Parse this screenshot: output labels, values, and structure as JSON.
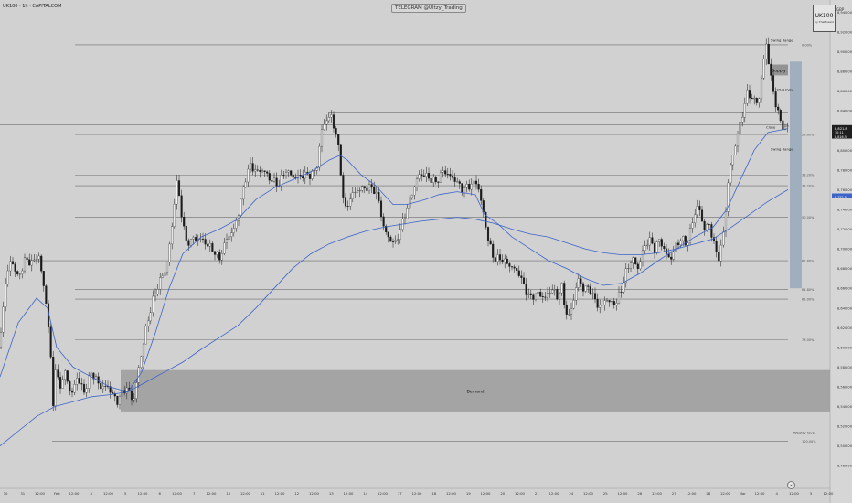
{
  "header": {
    "symbol": "UK100 · 1h · CAPITALCOM",
    "telegram": "TELEGRAM @Ultzy_Trading",
    "logo_title": "UK100",
    "logo_sub": "by TheMosaid",
    "currency": "GBP",
    "scroll_icon": "chevron-down-icon"
  },
  "colors": {
    "background": "#d1d1d1",
    "candle": "#1a1a1a",
    "ma_fast": "#3b63c8",
    "ma_slow": "#3b63c8",
    "zone_fill": "#9c9c9c",
    "fib_bar": "#8fa3b5",
    "price_badge": "#1f1f1f",
    "ma_badge": "#3b63c8"
  },
  "chart_data": {
    "type": "candlestick",
    "ylim": [
      8470,
      8945
    ],
    "y_ticks": [
      "8,940.00",
      "8,920.00",
      "8,900.00",
      "8,880.00",
      "8,860.00",
      "8,840.00",
      "8,820.00",
      "8,800.00",
      "8,780.00",
      "8,760.00",
      "8,740.00",
      "8,720.00",
      "8,700.00",
      "8,680.00",
      "8,660.00",
      "8,640.00",
      "8,620.00",
      "8,600.00",
      "8,580.00",
      "8,560.00",
      "8,540.00",
      "8,520.00",
      "8,500.00",
      "8,480.00"
    ],
    "x_ticks": [
      "30",
      "31",
      "12:00",
      "Feb",
      "12:00",
      "4",
      "12:00",
      "5",
      "12:00",
      "6",
      "12:00",
      "7",
      "12:00",
      "10",
      "12:00",
      "11",
      "12:00",
      "12",
      "12:00",
      "13",
      "12:00",
      "14",
      "12:00",
      "17",
      "12:00",
      "18",
      "12:00",
      "19",
      "12:00",
      "20",
      "12:00",
      "21",
      "12:00",
      "24",
      "12:00",
      "25",
      "12:00",
      "26",
      "12:00",
      "27",
      "12:00",
      "28",
      "12:00",
      "Mar",
      "12:00",
      "4",
      "12:00",
      "5",
      "12:00"
    ],
    "close_path": [
      [
        0,
        8600
      ],
      [
        5,
        8660
      ],
      [
        12,
        8690
      ],
      [
        20,
        8670
      ],
      [
        28,
        8690
      ],
      [
        35,
        8685
      ],
      [
        42,
        8695
      ],
      [
        50,
        8650
      ],
      [
        55,
        8600
      ],
      [
        58,
        8540
      ],
      [
        60,
        8580
      ],
      [
        65,
        8560
      ],
      [
        72,
        8575
      ],
      [
        78,
        8550
      ],
      [
        84,
        8570
      ],
      [
        92,
        8555
      ],
      [
        100,
        8575
      ],
      [
        110,
        8560
      ],
      [
        118,
        8560
      ],
      [
        128,
        8545
      ],
      [
        138,
        8560
      ],
      [
        146,
        8545
      ],
      [
        152,
        8580
      ],
      [
        160,
        8620
      ],
      [
        168,
        8650
      ],
      [
        176,
        8670
      ],
      [
        182,
        8680
      ],
      [
        188,
        8720
      ],
      [
        193,
        8770
      ],
      [
        198,
        8740
      ],
      [
        204,
        8705
      ],
      [
        210,
        8710
      ],
      [
        220,
        8710
      ],
      [
        232,
        8700
      ],
      [
        240,
        8690
      ],
      [
        248,
        8710
      ],
      [
        256,
        8720
      ],
      [
        262,
        8740
      ],
      [
        268,
        8770
      ],
      [
        274,
        8785
      ],
      [
        280,
        8778
      ],
      [
        288,
        8780
      ],
      [
        296,
        8770
      ],
      [
        305,
        8765
      ],
      [
        312,
        8780
      ],
      [
        322,
        8772
      ],
      [
        332,
        8775
      ],
      [
        340,
        8775
      ],
      [
        346,
        8780
      ],
      [
        352,
        8820
      ],
      [
        356,
        8830
      ],
      [
        362,
        8835
      ],
      [
        368,
        8815
      ],
      [
        372,
        8790
      ],
      [
        374,
        8760
      ],
      [
        378,
        8740
      ],
      [
        385,
        8755
      ],
      [
        392,
        8760
      ],
      [
        400,
        8762
      ],
      [
        408,
        8762
      ],
      [
        414,
        8750
      ],
      [
        420,
        8720
      ],
      [
        426,
        8710
      ],
      [
        432,
        8705
      ],
      [
        438,
        8720
      ],
      [
        445,
        8740
      ],
      [
        452,
        8760
      ],
      [
        458,
        8775
      ],
      [
        465,
        8775
      ],
      [
        472,
        8770
      ],
      [
        478,
        8768
      ],
      [
        485,
        8780
      ],
      [
        490,
        8775
      ],
      [
        498,
        8770
      ],
      [
        506,
        8760
      ],
      [
        515,
        8765
      ],
      [
        522,
        8768
      ],
      [
        528,
        8740
      ],
      [
        534,
        8710
      ],
      [
        540,
        8690
      ],
      [
        548,
        8690
      ],
      [
        555,
        8685
      ],
      [
        562,
        8680
      ],
      [
        568,
        8675
      ],
      [
        574,
        8660
      ],
      [
        580,
        8650
      ],
      [
        588,
        8655
      ],
      [
        596,
        8650
      ],
      [
        604,
        8660
      ],
      [
        610,
        8650
      ],
      [
        614,
        8665
      ],
      [
        618,
        8640
      ],
      [
        622,
        8630
      ],
      [
        628,
        8650
      ],
      [
        632,
        8670
      ],
      [
        638,
        8660
      ],
      [
        645,
        8660
      ],
      [
        652,
        8645
      ],
      [
        658,
        8640
      ],
      [
        662,
        8650
      ],
      [
        668,
        8645
      ],
      [
        674,
        8645
      ],
      [
        680,
        8660
      ],
      [
        686,
        8680
      ],
      [
        692,
        8690
      ],
      [
        698,
        8680
      ],
      [
        704,
        8700
      ],
      [
        710,
        8710
      ],
      [
        716,
        8700
      ],
      [
        722,
        8710
      ],
      [
        728,
        8695
      ],
      [
        734,
        8690
      ],
      [
        740,
        8705
      ],
      [
        746,
        8710
      ],
      [
        752,
        8705
      ],
      [
        758,
        8730
      ],
      [
        764,
        8745
      ],
      [
        770,
        8720
      ],
      [
        776,
        8725
      ],
      [
        782,
        8700
      ],
      [
        787,
        8690
      ],
      [
        792,
        8720
      ],
      [
        798,
        8780
      ],
      [
        803,
        8800
      ],
      [
        808,
        8820
      ],
      [
        813,
        8840
      ],
      [
        818,
        8860
      ],
      [
        824,
        8850
      ],
      [
        830,
        8850
      ],
      [
        834,
        8880
      ],
      [
        838,
        8910
      ],
      [
        842,
        8880
      ],
      [
        846,
        8860
      ],
      [
        850,
        8840
      ],
      [
        854,
        8830
      ],
      [
        858,
        8820
      ],
      [
        862,
        8825
      ]
    ],
    "series": [
      {
        "name": "",
        "values_path": [
          [
            0,
            8570
          ],
          [
            20,
            8625
          ],
          [
            40,
            8650
          ],
          [
            52,
            8640
          ],
          [
            62,
            8600
          ],
          [
            80,
            8580
          ],
          [
            100,
            8570
          ],
          [
            120,
            8560
          ],
          [
            140,
            8555
          ],
          [
            155,
            8575
          ],
          [
            170,
            8615
          ],
          [
            185,
            8660
          ],
          [
            200,
            8695
          ],
          [
            220,
            8712
          ],
          [
            240,
            8720
          ],
          [
            260,
            8730
          ],
          [
            280,
            8750
          ],
          [
            300,
            8762
          ],
          [
            320,
            8770
          ],
          [
            340,
            8778
          ],
          [
            360,
            8790
          ],
          [
            372,
            8795
          ],
          [
            380,
            8790
          ],
          [
            395,
            8775
          ],
          [
            410,
            8765
          ],
          [
            430,
            8745
          ],
          [
            445,
            8745
          ],
          [
            465,
            8750
          ],
          [
            480,
            8755
          ],
          [
            500,
            8758
          ],
          [
            520,
            8755
          ],
          [
            530,
            8735
          ],
          [
            545,
            8725
          ],
          [
            560,
            8712
          ],
          [
            580,
            8700
          ],
          [
            600,
            8688
          ],
          [
            620,
            8680
          ],
          [
            640,
            8670
          ],
          [
            660,
            8663
          ],
          [
            680,
            8665
          ],
          [
            700,
            8675
          ],
          [
            720,
            8688
          ],
          [
            740,
            8700
          ],
          [
            760,
            8712
          ],
          [
            780,
            8722
          ],
          [
            795,
            8740
          ],
          [
            810,
            8770
          ],
          [
            825,
            8800
          ],
          [
            840,
            8818
          ],
          [
            862,
            8822
          ]
        ]
      },
      {
        "name": "",
        "values_path": [
          [
            0,
            8500
          ],
          [
            20,
            8515
          ],
          [
            40,
            8530
          ],
          [
            60,
            8540
          ],
          [
            80,
            8545
          ],
          [
            100,
            8550
          ],
          [
            120,
            8552
          ],
          [
            140,
            8555
          ],
          [
            160,
            8565
          ],
          [
            180,
            8575
          ],
          [
            200,
            8585
          ],
          [
            220,
            8598
          ],
          [
            240,
            8610
          ],
          [
            260,
            8622
          ],
          [
            280,
            8640
          ],
          [
            300,
            8660
          ],
          [
            320,
            8680
          ],
          [
            340,
            8695
          ],
          [
            360,
            8705
          ],
          [
            380,
            8712
          ],
          [
            400,
            8718
          ],
          [
            420,
            8722
          ],
          [
            440,
            8725
          ],
          [
            460,
            8728
          ],
          [
            480,
            8730
          ],
          [
            500,
            8732
          ],
          [
            520,
            8730
          ],
          [
            540,
            8726
          ],
          [
            560,
            8720
          ],
          [
            580,
            8715
          ],
          [
            600,
            8712
          ],
          [
            620,
            8706
          ],
          [
            640,
            8700
          ],
          [
            660,
            8696
          ],
          [
            680,
            8694
          ],
          [
            700,
            8694
          ],
          [
            720,
            8696
          ],
          [
            740,
            8700
          ],
          [
            760,
            8705
          ],
          [
            780,
            8710
          ],
          [
            800,
            8722
          ],
          [
            820,
            8735
          ],
          [
            840,
            8748
          ],
          [
            862,
            8760
          ]
        ]
      }
    ],
    "levels": [
      {
        "label": "0.00%",
        "value": 8907,
        "x_start": 82
      },
      {
        "label": "",
        "value": 8838,
        "x_start": 360
      },
      {
        "label": "",
        "value": 8826,
        "x_start": 0
      },
      {
        "label": "23.60%",
        "value": 8816,
        "x_start": 82
      },
      {
        "label": "38.20%",
        "value": 8775,
        "x_start": 82
      },
      {
        "label": "38.20%",
        "value": 8764,
        "x_start": 82
      },
      {
        "label": "50.00%",
        "value": 8732,
        "x_start": 82
      },
      {
        "label": "61.80%",
        "value": 8688,
        "x_start": 30
      },
      {
        "label": "61.80%",
        "value": 8659,
        "x_start": 82
      },
      {
        "label": "65.00%",
        "value": 8649,
        "x_start": 82
      },
      {
        "label": "73.00%",
        "value": 8608,
        "x_start": 82
      },
      {
        "label": "100.00%",
        "value": 8505,
        "x_start": 57
      }
    ],
    "zones": [
      {
        "label": "Demand",
        "top": 8577,
        "bottom": 8535,
        "x_start": 132,
        "x_end": 908
      },
      {
        "label": "Supply",
        "top": 8887,
        "bottom": 8876,
        "x_start": 842,
        "x_end": 862
      }
    ],
    "annotations": [
      "Swing Range",
      "Supply",
      "1D/4 FVG",
      "Close",
      "Swing Range",
      "Demand",
      "Weekly level"
    ],
    "price_labels": [
      "8,821.8",
      "10:11",
      "8,816.5",
      "8,752.5"
    ]
  }
}
